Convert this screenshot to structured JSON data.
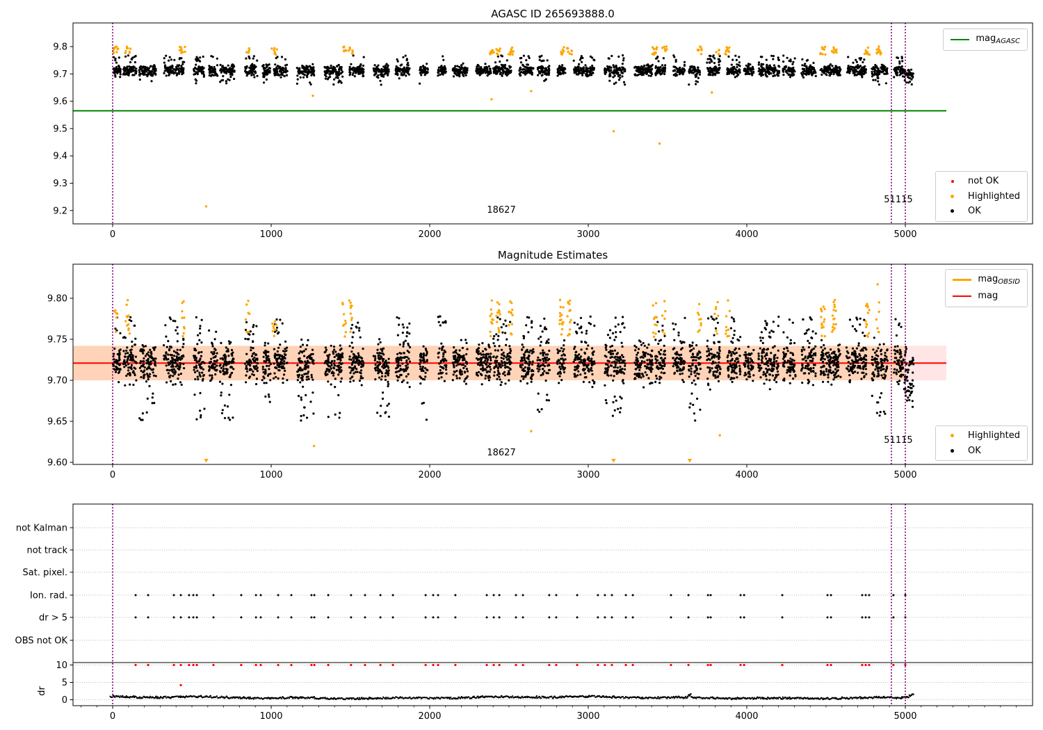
{
  "colors": {
    "green": "#008000",
    "red": "#ff0000",
    "orange": "#ffa500",
    "purple": "#800080",
    "black": "#000000",
    "band_pink": "rgba(255,0,0,0.10)",
    "band_salmon": "rgba(255,140,0,0.20)",
    "grid": "#9a9a9a",
    "legend_border": "#cccccc"
  },
  "chart_data": [
    {
      "type": "scatter",
      "title": "AGASC ID 265693888.0",
      "xlim": [
        -250,
        5800
      ],
      "ylim": [
        9.151,
        9.886
      ],
      "xticks": [
        0,
        1000,
        2000,
        3000,
        4000,
        5000
      ],
      "xtick_labels": [
        "0",
        "1000",
        "2000",
        "3000",
        "4000",
        "5000"
      ],
      "yticks": [
        9.8,
        9.7,
        9.6,
        9.5,
        9.4,
        9.3,
        9.2
      ],
      "ytick_labels": [
        "9.8",
        "9.7",
        "9.6",
        "9.5",
        "9.4",
        "9.3",
        "9.2"
      ],
      "legend_top": {
        "entries": [
          {
            "label_main": "mag",
            "label_sub": "AGASC",
            "color": "#008000",
            "type": "line",
            "weight": 2
          }
        ]
      },
      "legend_bottom": {
        "entries": [
          {
            "label": "not OK",
            "color": "#ff0000",
            "type": "marker"
          },
          {
            "label": "Highlighted",
            "color": "#ffa500",
            "type": "marker"
          },
          {
            "label": "OK",
            "color": "#000000",
            "type": "marker"
          }
        ]
      },
      "hline": {
        "name": "mag_AGASC",
        "y": 9.565,
        "color": "#008000"
      },
      "vlines": {
        "x": [
          0,
          4912,
          5000
        ],
        "color": "#800080"
      },
      "annotations": [
        {
          "text": "18627",
          "x": 2452
        },
        {
          "text": "51115",
          "x": 4956
        }
      ],
      "ok_series": {
        "color": "#000000",
        "band_center": 9.712,
        "band_halfwidth": 0.045,
        "x_range": [
          0,
          5055
        ]
      },
      "highlighted_series": {
        "color": "#ffa500",
        "y_range": [
          9.768,
          9.802
        ],
        "group_centers": [
          20,
          95,
          440,
          850,
          1020,
          1460,
          1500,
          2390,
          2430,
          2510,
          2830,
          2880,
          3420,
          3480,
          3700,
          3810,
          3880,
          4480,
          4550,
          4760,
          4830
        ]
      },
      "highlighted_outliers": [
        [
          590,
          9.215
        ],
        [
          1263,
          9.62
        ],
        [
          2390,
          9.607
        ],
        [
          2640,
          9.637
        ],
        [
          3160,
          9.49
        ],
        [
          3450,
          9.445
        ],
        [
          3780,
          9.632
        ]
      ],
      "not_ok_series": {
        "color": "#ff0000",
        "points": []
      }
    },
    {
      "type": "scatter",
      "title": "Magnitude Estimates",
      "xlim": [
        -250,
        5800
      ],
      "ylim": [
        9.5975,
        9.8415
      ],
      "xticks": [
        0,
        1000,
        2000,
        3000,
        4000,
        5000
      ],
      "xtick_labels": [
        "0",
        "1000",
        "2000",
        "3000",
        "4000",
        "5000"
      ],
      "yticks": [
        9.8,
        9.75,
        9.7,
        9.65,
        9.6
      ],
      "ytick_labels": [
        "9.80",
        "9.75",
        "9.70",
        "9.65",
        "9.60"
      ],
      "legend_top": {
        "entries": [
          {
            "label_main": "mag",
            "label_sub": "OBSID",
            "color": "#ffa500",
            "type": "line",
            "weight": 3
          },
          {
            "label_main": "mag",
            "label_sub": "",
            "color": "#ff0000",
            "type": "line",
            "weight": 2
          }
        ]
      },
      "legend_bottom": {
        "entries": [
          {
            "label": "Highlighted",
            "color": "#ffa500",
            "type": "marker"
          },
          {
            "label": "OK",
            "color": "#000000",
            "type": "marker"
          }
        ]
      },
      "hline": {
        "name": "mag",
        "y": 9.721,
        "color": "#ff0000"
      },
      "band": {
        "y_range": [
          9.7,
          9.742
        ]
      },
      "vlines": {
        "x": [
          0,
          4912,
          5000
        ],
        "color": "#800080"
      },
      "annotations": [
        {
          "text": "18627",
          "x": 2452
        },
        {
          "text": "51115",
          "x": 4956
        }
      ],
      "ok_series": {
        "color": "#000000",
        "band_center": 9.721,
        "band_halfwidth": 0.055,
        "x_range": [
          0,
          5055
        ]
      },
      "highlighted_series": {
        "color": "#ffa500",
        "y_range": [
          9.752,
          9.798
        ],
        "group_centers": [
          20,
          95,
          440,
          850,
          1020,
          1460,
          1500,
          2390,
          2430,
          2510,
          2830,
          2880,
          3420,
          3480,
          3700,
          3810,
          3880,
          4480,
          4550,
          4760,
          4830
        ]
      },
      "highlighted_outliers_low": [
        [
          1270,
          9.62
        ],
        [
          2640,
          9.638
        ],
        [
          3830,
          9.633
        ]
      ],
      "highlighted_outliers_high": [
        [
          4825,
          9.817
        ],
        [
          4553,
          9.792
        ]
      ],
      "clipped_markers_x": [
        590,
        3160,
        3640
      ]
    },
    {
      "type": "scatter",
      "title": "",
      "categories": [
        "not Kalman",
        "not track",
        "Sat. pixel.",
        "Ion. rad.",
        "dr > 5",
        "OBS not OK"
      ],
      "active_categories": [
        "Ion. rad.",
        "dr > 5"
      ],
      "dr_axis": {
        "label": "dr",
        "ticks": [
          10,
          5,
          0
        ],
        "tick_labels": [
          "10",
          "5",
          "0"
        ]
      },
      "xticks": [
        0,
        1000,
        2000,
        3000,
        4000,
        5000
      ],
      "xtick_labels": [
        "0",
        "1000",
        "2000",
        "3000",
        "4000",
        "5000"
      ],
      "flag_x": [
        145,
        224,
        386,
        430,
        482,
        509,
        531,
        636,
        811,
        904,
        934,
        1044,
        1127,
        1254,
        1272,
        1360,
        1504,
        1592,
        1689,
        1768,
        1974,
        2022,
        2053,
        2162,
        2360,
        2404,
        2439,
        2544,
        2588,
        2754,
        2798,
        2930,
        3061,
        3105,
        3149,
        3237,
        3281,
        3522,
        3632,
        3755,
        3772,
        3961,
        3983,
        4224,
        4509,
        4531,
        4728,
        4750,
        4772,
        4925,
        5000
      ],
      "flag_color": "#000000",
      "dr10_color": "#ff0000",
      "dr_outlier": [
        430,
        4.2
      ],
      "dr_trace": {
        "color": "#000000",
        "typical": 0.7,
        "x_range": [
          -15,
          5055
        ],
        "mid_spike_x": 3640,
        "end_spike_x": 5010
      },
      "threshold_line_dr": 10.7,
      "vlines": {
        "x": [
          0,
          4912,
          5000
        ],
        "color": "#800080"
      }
    }
  ]
}
